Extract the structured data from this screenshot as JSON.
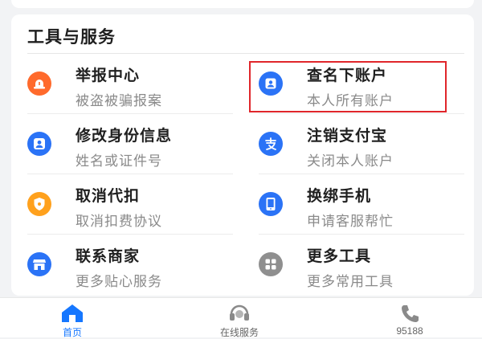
{
  "section": {
    "title": "工具与服务"
  },
  "items": [
    {
      "title": "举报中心",
      "subtitle": "被盗被骗报案",
      "icon": "alarm-icon",
      "color": "#ff6a2c"
    },
    {
      "title": "查名下账户",
      "subtitle": "本人所有账户",
      "icon": "account-card-icon",
      "color": "#2b73f6"
    },
    {
      "title": "修改身份信息",
      "subtitle": "姓名或证件号",
      "icon": "user-icon",
      "color": "#2b73f6"
    },
    {
      "title": "注销支付宝",
      "subtitle": "关闭本人账户",
      "icon": "alipay-icon",
      "color": "#2b73f6"
    },
    {
      "title": "取消代扣",
      "subtitle": "取消扣费协议",
      "icon": "shield-icon",
      "color": "#ffa11d"
    },
    {
      "title": "换绑手机",
      "subtitle": "申请客服帮忙",
      "icon": "phone-icon",
      "color": "#2b73f6"
    },
    {
      "title": "联系商家",
      "subtitle": "更多贴心服务",
      "icon": "store-icon",
      "color": "#2b73f6"
    },
    {
      "title": "更多工具",
      "subtitle": "更多常用工具",
      "icon": "grid-icon",
      "color": "#8f8f8f"
    }
  ],
  "tabs": [
    {
      "label": "首页",
      "icon": "home-icon",
      "active": true
    },
    {
      "label": "在线服务",
      "icon": "headset-icon",
      "active": false
    },
    {
      "label": "95188",
      "icon": "phone-handset-icon",
      "active": false
    }
  ],
  "colors": {
    "accent": "#1677ff",
    "highlight_border": "#e0262b"
  }
}
